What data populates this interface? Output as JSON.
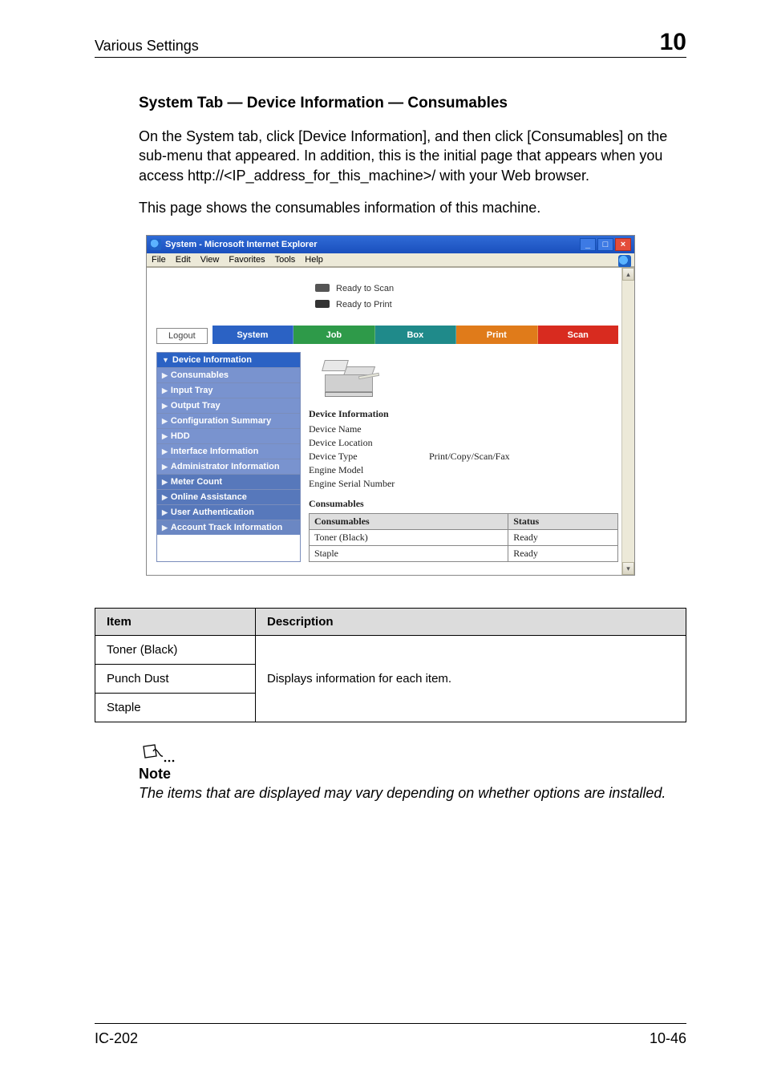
{
  "header": {
    "left": "Various Settings",
    "chapter": "10"
  },
  "heading": "System Tab — Device Information — Consumables",
  "paragraph1": "On the System tab, click [Device Information], and then click [Consumables] on the sub-menu that appeared. In addition, this is the initial page that appears when you access http://<IP_address_for_this_machine>/ with your Web browser.",
  "paragraph2": "This page shows the consumables information of this machine.",
  "screenshot": {
    "title": "System - Microsoft Internet Explorer",
    "menubar": {
      "file": "File",
      "edit": "Edit",
      "view": "View",
      "favorites": "Favorites",
      "tools": "Tools",
      "help": "Help"
    },
    "status": {
      "scan": "Ready to Scan",
      "print": "Ready to Print"
    },
    "logout": "Logout",
    "tabs": {
      "system": "System",
      "job": "Job",
      "box": "Box",
      "print": "Print",
      "scan": "Scan"
    },
    "side": {
      "devinfo": "Device Information",
      "consumables": "Consumables",
      "inputtray": "Input Tray",
      "outputtray": "Output Tray",
      "cfgsummary": "Configuration Summary",
      "hdd": "HDD",
      "ifinfo": "Interface Information",
      "admininfo": "Administrator Information",
      "meter": "Meter Count",
      "online": "Online Assistance",
      "userauth": "User Authentication",
      "account": "Account Track Information"
    },
    "device": {
      "section": "Device Information",
      "name_lbl": "Device Name",
      "location_lbl": "Device Location",
      "type_lbl": "Device Type",
      "type_val": "Print/Copy/Scan/Fax",
      "model_lbl": "Engine Model",
      "serial_lbl": "Engine Serial Number"
    },
    "consumables": {
      "section": "Consumables",
      "col1": "Consumables",
      "col2": "Status",
      "rows": [
        {
          "name": "Toner (Black)",
          "status": "Ready"
        },
        {
          "name": "Staple",
          "status": "Ready"
        }
      ]
    }
  },
  "doc_table": {
    "h1": "Item",
    "h2": "Description",
    "items": [
      "Toner (Black)",
      "Punch Dust",
      "Staple"
    ],
    "desc": "Displays information for each item."
  },
  "note": {
    "label": "Note",
    "text": "The items that are displayed may vary depending on whether options are installed."
  },
  "footer": {
    "left": "IC-202",
    "right": "10-46"
  }
}
